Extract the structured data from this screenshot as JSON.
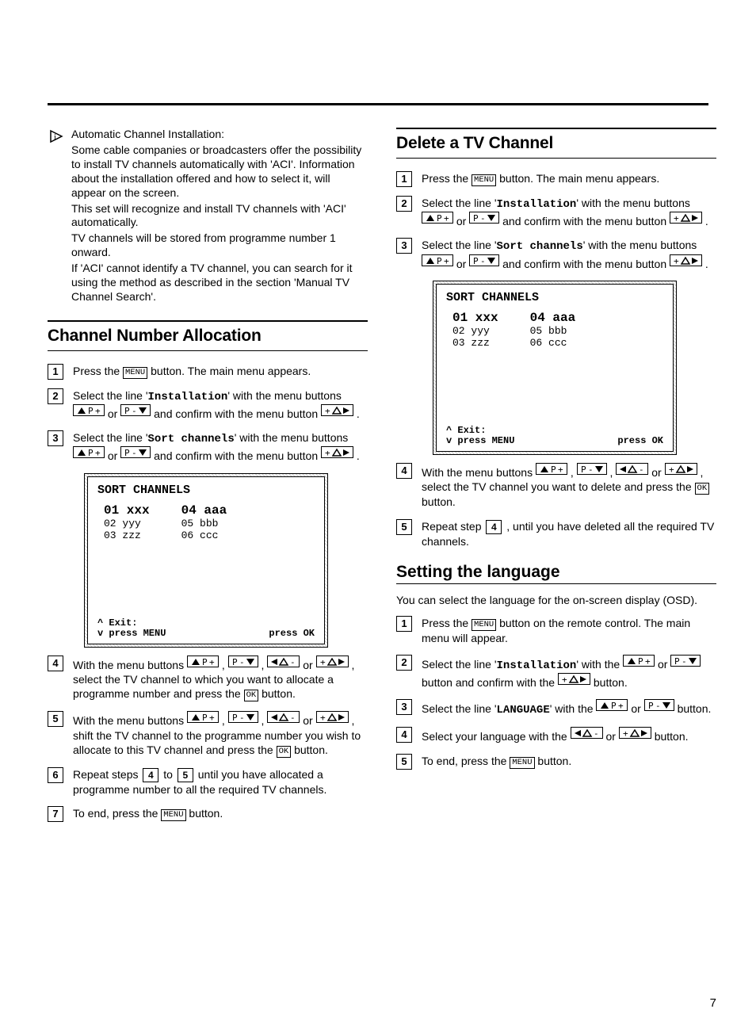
{
  "intro": {
    "title": "Automatic Channel Installation:",
    "p1": "Some cable companies or broadcasters offer the possibility to install TV channels automatically with 'ACI'. Information about the installation offered and how to select it, will appear on the screen.",
    "p2": "This set will recognize and install TV channels with 'ACI' automatically.",
    "p3": "TV channels will be stored from programme number 1 onward.",
    "p4": "If 'ACI' cannot identify a TV channel, you can search for it using the method as described in the section 'Manual TV Channel Search'."
  },
  "h_channelnum": "Channel Number Allocation",
  "h_delete": "Delete a TV Channel",
  "h_lang": "Setting the language",
  "lang_intro": "You can select the language for the on-screen display (OSD).",
  "btn": {
    "menu": "MENU",
    "ok": "OK"
  },
  "mono": {
    "install": "Installation",
    "sort": "Sort channels",
    "language": "LANGUAGE"
  },
  "screen": {
    "title": "SORT CHANNELS",
    "c1": [
      "01 xxx",
      "02 yyy",
      "03 zzz"
    ],
    "c2": [
      "04 aaa",
      "05 bbb",
      "06 ccc"
    ],
    "footer_left1": "^ Exit:",
    "footer_left2": "v press MENU",
    "footer_right": "press OK"
  },
  "text": {
    "press_the": "Press the ",
    "button_main_appears": " button. The main menu appears.",
    "button_remote_main_appear": " button on the remote control. The main menu will appear.",
    "select_line": "Select the line '",
    "with_menu_buttons": "' with the menu buttons ",
    "with_the": "' with the ",
    "or": " or ",
    "confirm_menu_button": " and confirm with the menu button ",
    "button_period": " button.",
    "period": ".",
    "cn_s4a": "With the menu buttons ",
    "cn_s4b": ", select the TV channel to which you want to allocate a programme number and press the ",
    "cn_s5b": ", shift the TV channel to the programme number you wish to allocate to this TV channel and press the ",
    "cn_s6a": "Repeat steps ",
    "cn_s6b": " to ",
    "cn_s6c": " until you have allocated a programme number to all the required TV channels.",
    "to_end_press": "To end, press the ",
    "del_s4b": ", select the TV channel you want to delete and press the ",
    "del_s5a": "Repeat step ",
    "del_s5b": ", until you have deleted all the required TV channels.",
    "lang_s2b": " button and confirm with the ",
    "lang_s4a": "Select your language with the "
  },
  "pagenum": "7"
}
